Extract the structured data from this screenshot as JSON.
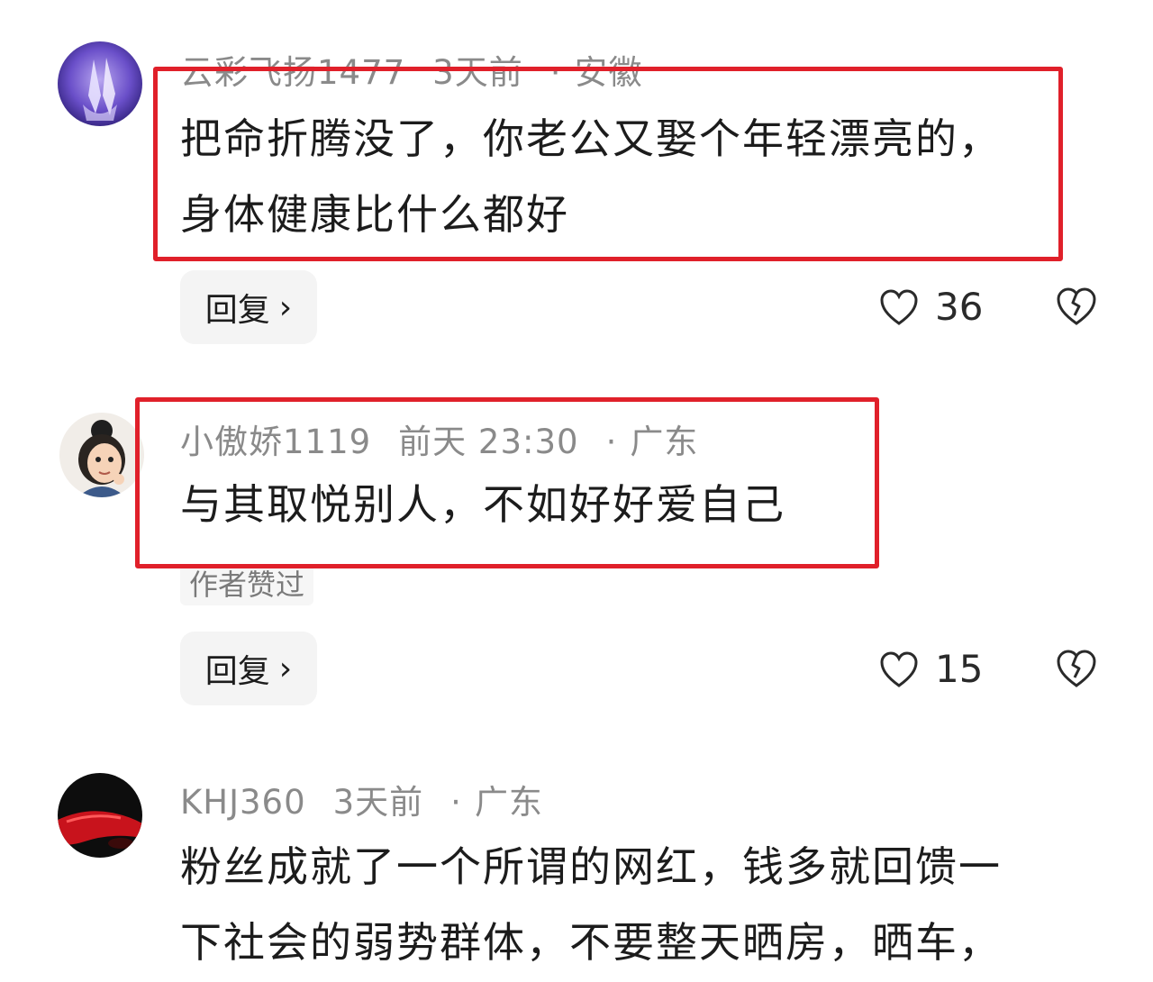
{
  "comments": [
    {
      "username": "云彩飞扬1477",
      "time": "3天前",
      "location": "安徽",
      "text_lines": [
        "把命折腾没了，你老公又娶个年轻漂亮的，",
        "身体健康比什么都好"
      ],
      "reply_label": "回复",
      "likes": "36",
      "avatar": "hands-avatar"
    },
    {
      "username": "小傲娇1119",
      "time": "前天 23:30",
      "location": "广东",
      "text_lines": [
        "与其取悦别人，不如好好爱自己"
      ],
      "author_liked": "作者赞过",
      "reply_label": "回复",
      "likes": "15",
      "avatar": "cartoon-girl-avatar"
    },
    {
      "username": "KHJ360",
      "time": "3天前",
      "location": "广东",
      "text_lines": [
        "粉丝成就了一个所谓的网红，钱多就回馈一",
        "下社会的弱势群体，不要整天晒房，晒车，"
      ],
      "avatar": "red-car-avatar"
    }
  ],
  "separator": "·",
  "reply_chevron": "›",
  "colors": {
    "highlight": "#e0202a",
    "meta": "#8a8a8a",
    "reply_bg": "#f4f4f4"
  },
  "icons": {
    "like": "heart-icon",
    "dislike": "broken-heart-icon"
  }
}
